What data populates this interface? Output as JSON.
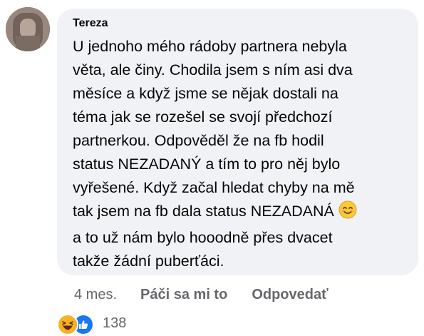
{
  "comment": {
    "author": "Tereza",
    "lines": [
      "U jednoho mého rádoby partnera nebyla",
      "věta, ale činy. Chodila jsem s ním asi dva",
      "měsíce a když jsme se nějak dostali na",
      "téma jak se rozešel se svojí předchozí",
      "partnerkou. Odpověděl že na fb hodil",
      "status NEZADANÝ a tím to pro něj bylo",
      "vyřešené. Když začal hledat chyby na mě",
      "tak jsem na fb dala status NEZADANÁ",
      "a to už nám bylo hooodně přes dvacet",
      "takže žádní puberťáci."
    ],
    "emoji_icon": "smiling-face-icon"
  },
  "actions": {
    "time": "4 mes.",
    "like_label": "Páči sa mi to",
    "reply_label": "Odpovedať"
  },
  "reactions": {
    "icons": [
      "haha-icon",
      "like-icon"
    ],
    "count": "138"
  },
  "colors": {
    "bubble": "#f0f2f5",
    "text": "#050505",
    "muted": "#65676b",
    "like_blue": "#1877f2",
    "haha_yellow": "#f7b125"
  }
}
